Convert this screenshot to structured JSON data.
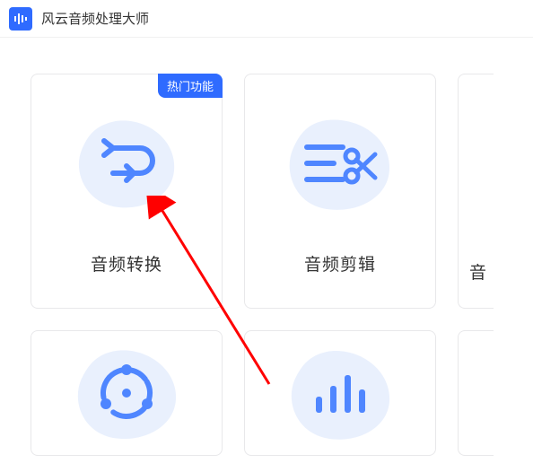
{
  "app": {
    "title": "风云音频处理大师"
  },
  "cards": {
    "convert": {
      "label": "音频转换",
      "badge": "热门功能"
    },
    "edit": {
      "label": "音频剪辑"
    },
    "thirdPartial": {
      "label": "音"
    }
  }
}
